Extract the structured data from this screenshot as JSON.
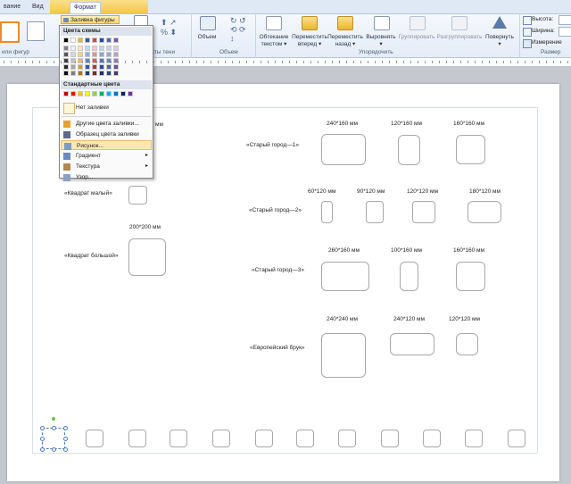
{
  "tabs": [
    "вание",
    "Вид",
    "Формат"
  ],
  "ribbon": {
    "fill_button": "Заливка фигуры",
    "shadow_group": "кты тени",
    "shape_styles_group": "или фигур",
    "volume": "Объем",
    "volume_group": "Объем",
    "wrap_text": [
      "Обтекание",
      "текстом"
    ],
    "bring_forward": [
      "Переместить",
      "вперед"
    ],
    "send_backward": [
      "Переместить",
      "назад"
    ],
    "align": "Выровнять",
    "group": "Группировать",
    "ungroup": "Разгруппировать",
    "rotate": [
      "Повернуть"
    ],
    "arrange_group": "Упорядочить",
    "height_label": "Высота:",
    "width_label": "Ширина:",
    "measure": "Измерение",
    "size_group": "Размер"
  },
  "dropdown": {
    "theme_colors_header": "Цвета схемы",
    "standard_colors_header": "Стандартные цвета",
    "theme_top_row": [
      "#000000",
      "#ffffff",
      "#e9b728",
      "#2c5aa0",
      "#c0504d",
      "#1f4e9a",
      "#4f6ba8",
      "#7f55a5"
    ],
    "theme_columns": [
      [
        "#7f7f7f",
        "#595959",
        "#3f3f3f",
        "#262626",
        "#0d0d0d"
      ],
      [
        "#f2f2f2",
        "#d9d9d9",
        "#bfbfbf",
        "#a6a6a6",
        "#808080"
      ],
      [
        "#fbe9b0",
        "#f7d36e",
        "#f2be3c",
        "#d9a01c",
        "#a87a10"
      ],
      [
        "#c6d6ee",
        "#8eaed9",
        "#5686c4",
        "#2c5aa0",
        "#1e3f70"
      ],
      [
        "#f0c8c6",
        "#e29390",
        "#d4605c",
        "#a83b37",
        "#7a2a27"
      ],
      [
        "#c5d2ea",
        "#8aa5d3",
        "#4f78bc",
        "#1f4e9a",
        "#15356a"
      ],
      [
        "#cad3e9",
        "#97a8d2",
        "#6a82bd",
        "#4a64a0",
        "#33467a"
      ],
      [
        "#dccbe6",
        "#baa0cf",
        "#9777b8",
        "#6f4f95",
        "#4c3668"
      ]
    ],
    "standard_colors": [
      "#c00000",
      "#ff0000",
      "#ffc000",
      "#ffff00",
      "#92d050",
      "#00b050",
      "#00b0f0",
      "#0070c0",
      "#002060",
      "#7030a0"
    ],
    "items": [
      {
        "label": "Нет заливки",
        "icon": "no-fill-icon",
        "arrow": false
      },
      {
        "label": "Другие цвета заливки...",
        "icon": "palette-icon",
        "arrow": false
      },
      {
        "label": "Образец цвета заливки",
        "icon": "eyedropper-icon",
        "arrow": false
      },
      {
        "label": "Рисунок...",
        "icon": "picture-icon",
        "arrow": false,
        "highlighted": true
      },
      {
        "label": "Градиент",
        "icon": "gradient-icon",
        "arrow": true
      },
      {
        "label": "Текстура",
        "icon": "texture-icon",
        "arrow": true
      },
      {
        "label": "Узор...",
        "icon": "pattern-icon",
        "arrow": false
      }
    ]
  },
  "page": {
    "left_labels": {
      "small_square": "«Квадрат малый»",
      "big_square": "«Квадрат большой»",
      "big_dim": "200*200 мм",
      "small_dim_partial": "мм"
    },
    "rows": [
      {
        "label": "«Старый город—1»",
        "dims": [
          "240*160 мм",
          "120*160 мм",
          "160*160 мм"
        ]
      },
      {
        "label": "«Старый город—2»",
        "dims": [
          "60*120 мм",
          "90*120 мм",
          "120*120 мм",
          "180*120 мм"
        ]
      },
      {
        "label": "«Старый город—3»",
        "dims": [
          "260*160 мм",
          "100*160 мм",
          "160*160 мм"
        ]
      },
      {
        "label": "«Европейский брук»",
        "dims": [
          "240*240 мм",
          "240*120 мм",
          "120*120 мм"
        ]
      }
    ]
  }
}
